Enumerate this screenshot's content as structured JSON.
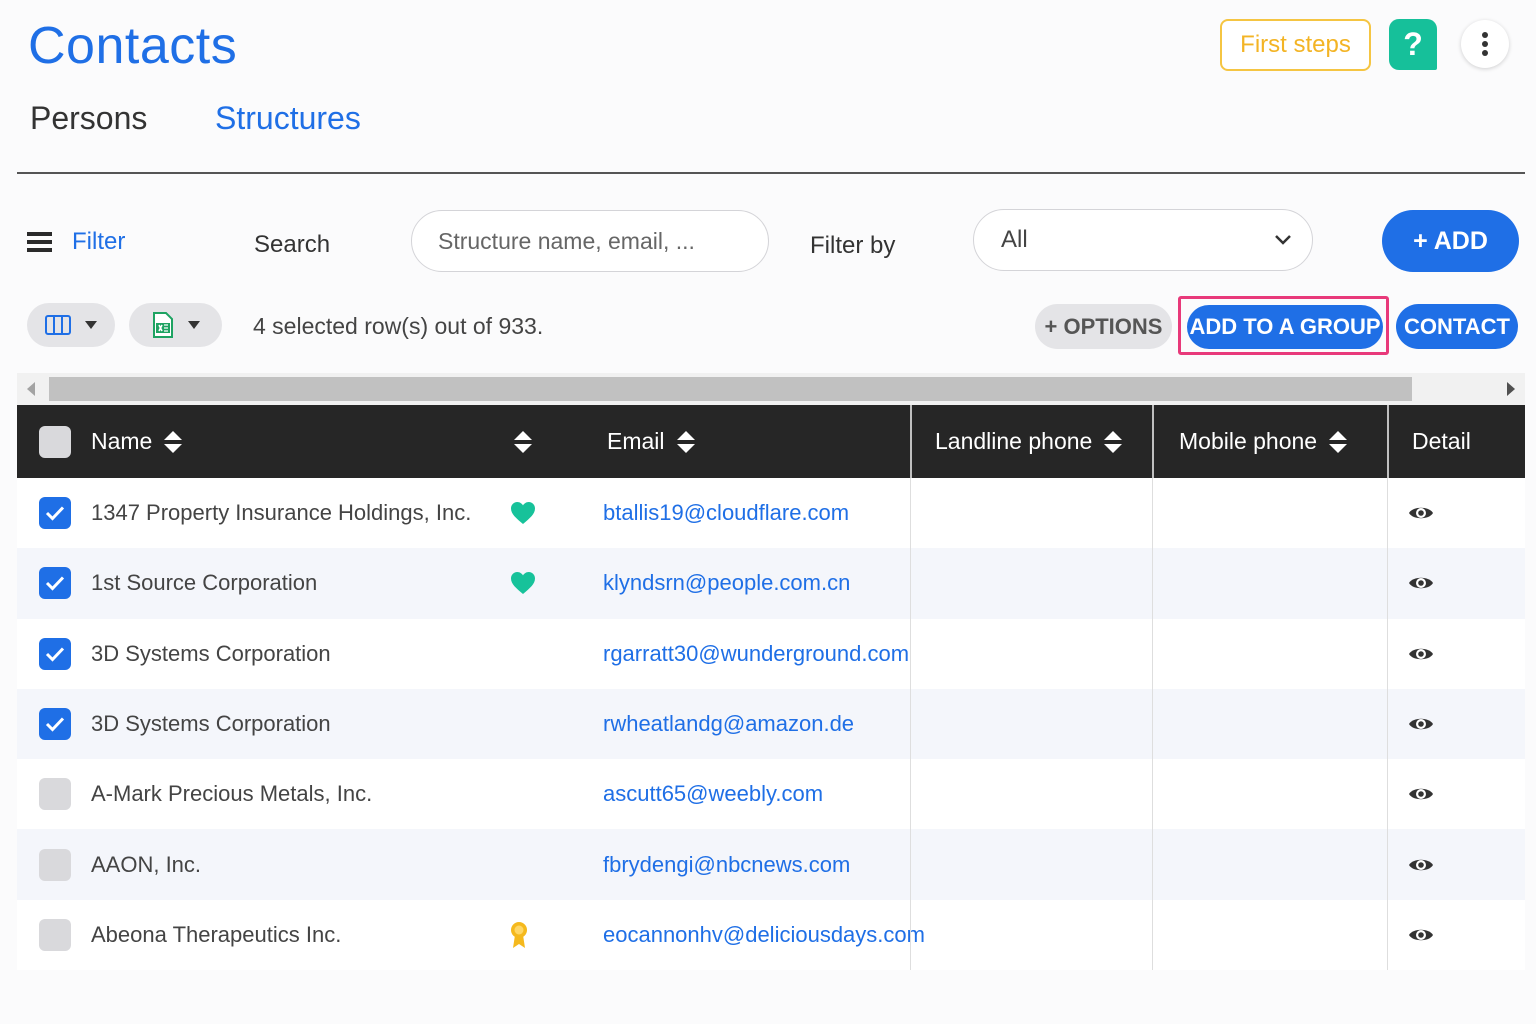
{
  "header": {
    "title": "Contacts",
    "first_steps_label": "First steps",
    "help_label": "?"
  },
  "tabs": [
    {
      "label": "Persons",
      "active": false
    },
    {
      "label": "Structures",
      "active": true
    }
  ],
  "toolbar": {
    "filter_label": "Filter",
    "search_label": "Search",
    "search_placeholder": "Structure name, email, ...",
    "filter_by_label": "Filter by",
    "filter_by_value": "All",
    "add_label": "+ ADD"
  },
  "actions": {
    "selection_text": "4 selected row(s) out of 933.",
    "options_label": "+ OPTIONS",
    "add_to_group_label": "ADD TO A GROUP",
    "contact_label": "CONTACT"
  },
  "table": {
    "columns": [
      "Name",
      "",
      "Email",
      "Landline phone",
      "Mobile phone",
      "Detail"
    ],
    "rows": [
      {
        "checked": true,
        "name": "1347 Property Insurance Holdings, Inc.",
        "badge": "heart-icon",
        "email": "btallis19@cloudflare.com",
        "landline": "",
        "mobile": ""
      },
      {
        "checked": true,
        "name": "1st Source Corporation",
        "badge": "heart-icon",
        "email": "klyndsrn@people.com.cn",
        "landline": "",
        "mobile": ""
      },
      {
        "checked": true,
        "name": "3D Systems Corporation",
        "badge": "",
        "email": "rgarratt30@wunderground.com",
        "landline": "",
        "mobile": ""
      },
      {
        "checked": true,
        "name": "3D Systems Corporation",
        "badge": "",
        "email": "rwheatlandg@amazon.de",
        "landline": "",
        "mobile": ""
      },
      {
        "checked": false,
        "name": "A-Mark Precious Metals, Inc.",
        "badge": "",
        "email": "ascutt65@weebly.com",
        "landline": "",
        "mobile": ""
      },
      {
        "checked": false,
        "name": "AAON, Inc.",
        "badge": "",
        "email": "fbrydengi@nbcnews.com",
        "landline": "",
        "mobile": ""
      },
      {
        "checked": false,
        "name": "Abeona Therapeutics Inc.",
        "badge": "award-ribbon-icon",
        "email": "eocannonhv@deliciousdays.com",
        "landline": "",
        "mobile": ""
      }
    ]
  },
  "colors": {
    "primary": "#1f6fe6",
    "highlight": "#e8397a",
    "help": "#16c09a",
    "first_steps": "#f3b425",
    "header_bg": "#262626"
  }
}
